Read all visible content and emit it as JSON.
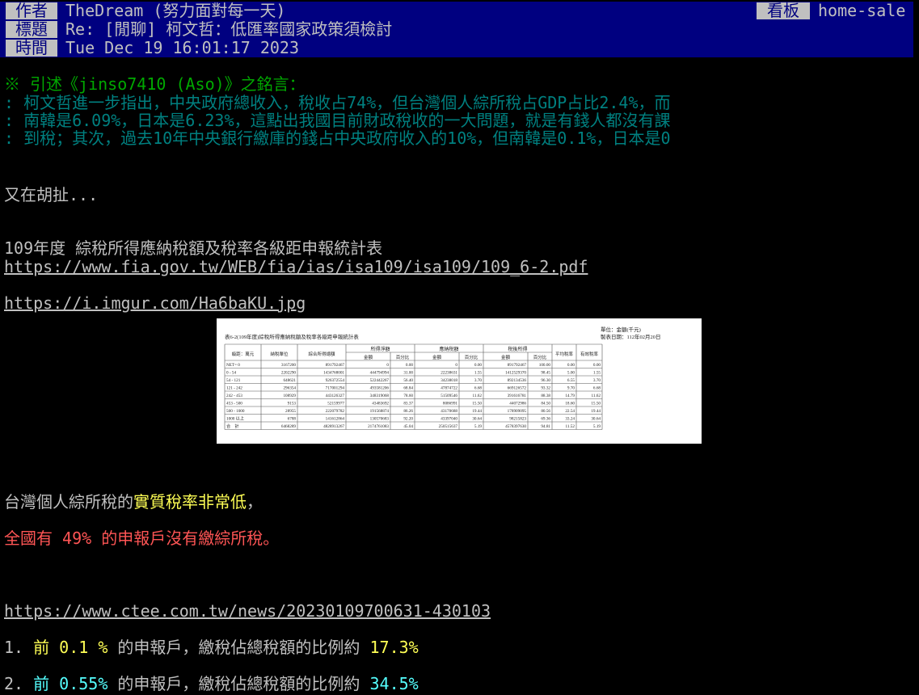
{
  "header": {
    "author_label": "作者",
    "author_value": "TheDream (努力面對每一天)",
    "board_label": "看板",
    "board_value": "home-sale",
    "title_label": "標題",
    "title_value": "Re: [閒聊] 柯文哲：低匯率國家政策須檢討",
    "time_label": "時間",
    "time_value": "Tue Dec 19 16:01:17 2023"
  },
  "quote": {
    "header": "※ 引述《jinso7410 (Aso)》之銘言：",
    "lines": [
      ": 柯文哲進一步指出，中央政府總收入，稅收占74%，但台灣個人綜所稅占GDP占比2.4%，而",
      ": 南韓是6.09%，日本是6.23%，這點出我國目前財政稅收的一大問題，就是有錢人都沒有課",
      ": 到稅；其次，過去10年中央銀行繳庫的錢占中央政府收入的10%，但南韓是0.1%，日本是0"
    ]
  },
  "body": {
    "line1": "又在胡扯...",
    "table_title": "109年度 綜稅所得應納稅額及稅率各級距申報統計表",
    "link_pdf": "https://www.fia.gov.tw/WEB/fia/ias/isa109/isa109/109_6-2.pdf",
    "link_img": "https://i.imgur.com/Ha6baKU.jpg",
    "statement_prefix": "台灣個人綜所稅的",
    "statement_highlight": "實質稅率非常低",
    "statement_suffix": "，",
    "red_line": "全國有 49% 的申報戶沒有繳綜所稅。",
    "link_news": "https://www.ctee.com.tw/news/20230109700631-430103",
    "items": [
      {
        "num": "1. ",
        "prefix": "前 ",
        "pct": "0.1 %",
        "mid": " 的申報戶，繳稅佔總稅額的比例約 ",
        "value": "17.3%"
      },
      {
        "num": "2. ",
        "prefix": "前 ",
        "pct": "0.55%",
        "mid": " 的申報戶，繳稅佔總稅額的比例約 ",
        "value": "34.5%"
      }
    ]
  },
  "image_preview": {
    "title": "表6-2(109年度)綜稅所得應納稅額及稅率各級距申報統計表",
    "unit": "單位：金額(千元)",
    "date": "製表日期：112年02月20日",
    "group_headers": [
      "所得淨額",
      "應納稅額",
      "稅後所得"
    ],
    "col_headers": [
      "級距：萬元",
      "納稅單位",
      "綜合所得總額",
      "金額",
      "百分比",
      "金額",
      "百分比",
      "金額",
      "百分比",
      "平均稅率",
      "有效稅率"
    ],
    "rows": [
      [
        "NET= 0",
        "3167200",
        "891792467",
        "0",
        "0.00",
        "0",
        "0.00",
        "891792467",
        "100.00",
        "0.00",
        "0.00"
      ],
      [
        "0 - 54",
        "2202290",
        "1434768001",
        "444794994",
        "31.00",
        "22238631",
        "1.55",
        "1412529370",
        "98.45",
        "5.00",
        "1.55"
      ],
      [
        "54 - 121",
        "648621",
        "926372554",
        "522442267",
        "56.40",
        "34238018",
        "3.70",
        "892134536",
        "96.30",
        "6.55",
        "3.70"
      ],
      [
        "121 - 242",
        "296354",
        "717001294",
        "493581206",
        "68.84",
        "47874722",
        "6.68",
        "669126572",
        "93.32",
        "9.70",
        "6.68"
      ],
      [
        "242 - 453",
        "108929",
        "443126327",
        "348319068",
        "78.60",
        "51509546",
        "11.62",
        "391616781",
        "88.38",
        "14.79",
        "11.62"
      ],
      [
        "453 - 500",
        "9153",
        "52159977",
        "43483692",
        "83.37",
        "8086991",
        "15.50",
        "44072986",
        "84.50",
        "18.60",
        "15.50"
      ],
      [
        "500 - 1000",
        "28955",
        "222079782",
        "191568874",
        "86.26",
        "43170688",
        "19.44",
        "178909095",
        "80.56",
        "22.54",
        "19.44"
      ],
      [
        "1000 以上",
        "6788",
        "141612864",
        "130570683",
        "92.20",
        "43397040",
        "30.64",
        "98215823",
        "69.36",
        "33.24",
        "30.64"
      ],
      [
        "合　計",
        "6468289",
        "4828913267",
        "2174761083",
        "45.04",
        "250515637",
        "5.19",
        "4578397630",
        "94.81",
        "11.52",
        "5.19"
      ]
    ]
  }
}
